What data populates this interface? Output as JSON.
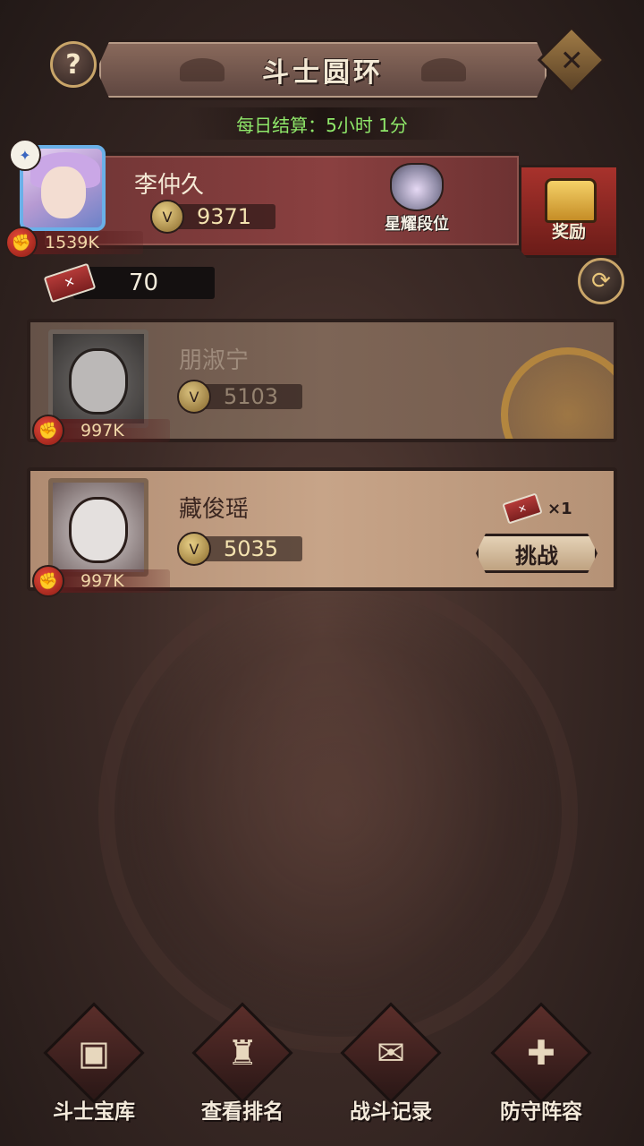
{
  "header": {
    "title": "斗士圆环",
    "help": "?",
    "close": "✕"
  },
  "settlement": "每日结算：5小时 1分",
  "player": {
    "name": "李仲久",
    "score": "9371",
    "power": "1539K",
    "rank_label": "星耀段位",
    "reward_label": "奖励",
    "tickets": "70"
  },
  "opponents": [
    {
      "name": "朋淑宁",
      "score": "5103",
      "power": "997K"
    },
    {
      "name": "藏俊瑶",
      "score": "5035",
      "power": "997K",
      "cost": "×1",
      "challenge_label": "挑战"
    }
  ],
  "bottom_nav": [
    {
      "label": "斗士宝库",
      "icon": "treasure-chest-icon"
    },
    {
      "label": "查看排名",
      "icon": "trophy-icon"
    },
    {
      "label": "战斗记录",
      "icon": "scroll-icon"
    },
    {
      "label": "防守阵容",
      "icon": "shield-icon"
    }
  ],
  "colors": {
    "settlement": "#8fe86a",
    "player_banner": "#8a4040",
    "reward": "#a8322c"
  }
}
